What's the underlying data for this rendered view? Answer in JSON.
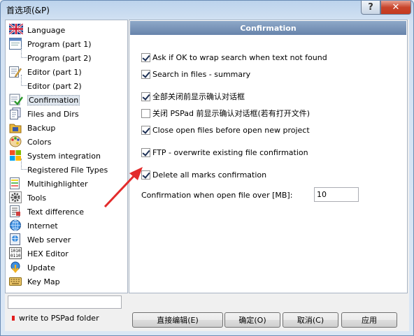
{
  "window": {
    "title": "首选项(&P)",
    "help_label": "?",
    "close_label": "✕"
  },
  "nav": {
    "items": [
      {
        "label": "Language",
        "icon": "uk-flag-icon"
      },
      {
        "label": "Program  (part 1)",
        "icon": "program-window-icon"
      },
      {
        "label": "Program  (part 2)",
        "icon": ""
      },
      {
        "label": "Editor  (part 1)",
        "icon": "editor-pencil-icon"
      },
      {
        "label": "Editor  (part 2)",
        "icon": ""
      },
      {
        "label": "Confirmation",
        "icon": "confirmation-check-icon"
      },
      {
        "label": "Files and Dirs",
        "icon": "files-icon"
      },
      {
        "label": "Backup",
        "icon": "backup-icon"
      },
      {
        "label": "Colors",
        "icon": "palette-icon"
      },
      {
        "label": "System integration",
        "icon": "windows-logo-icon"
      },
      {
        "label": "Registered File Types",
        "icon": ""
      },
      {
        "label": "Multihighlighter",
        "icon": "highlighter-icon"
      },
      {
        "label": "Tools",
        "icon": "gear-icon"
      },
      {
        "label": "Text difference",
        "icon": "text-diff-icon"
      },
      {
        "label": "Internet",
        "icon": "globe-icon"
      },
      {
        "label": "Web server",
        "icon": "server-icon"
      },
      {
        "label": "HEX Editor",
        "icon": "hex-icon"
      },
      {
        "label": "Update",
        "icon": "update-icon"
      },
      {
        "label": "Key Map",
        "icon": "keyboard-icon"
      }
    ],
    "selected": "Confirmation",
    "search_value": "",
    "folder_note": "write to PSPad folder"
  },
  "panel": {
    "header": "Confirmation",
    "checkboxes": [
      {
        "label": "Ask if OK to wrap search when text not found",
        "checked": true
      },
      {
        "label": "Search in files - summary",
        "checked": true
      },
      {
        "label": "全部关闭前显示确认对话框",
        "checked": true
      },
      {
        "label": "关闭 PSPad 前显示确认对话框(若有打开文件)",
        "checked": false
      },
      {
        "label": "Close open files before open new project",
        "checked": true
      },
      {
        "label": "FTP - overwrite existing file confirmation",
        "checked": true
      },
      {
        "label": "Delete all marks confirmation",
        "checked": true
      }
    ],
    "size_label": "Confirmation when open file over [MB]:",
    "size_value": "10"
  },
  "buttons": {
    "edit": "直接编辑(E)",
    "ok": "确定(O)",
    "cancel": "取消(C)",
    "apply": "应用"
  },
  "colors": {
    "header": "#7793b8",
    "arrow": "#e32b2b",
    "marker": "#e31d1d"
  }
}
